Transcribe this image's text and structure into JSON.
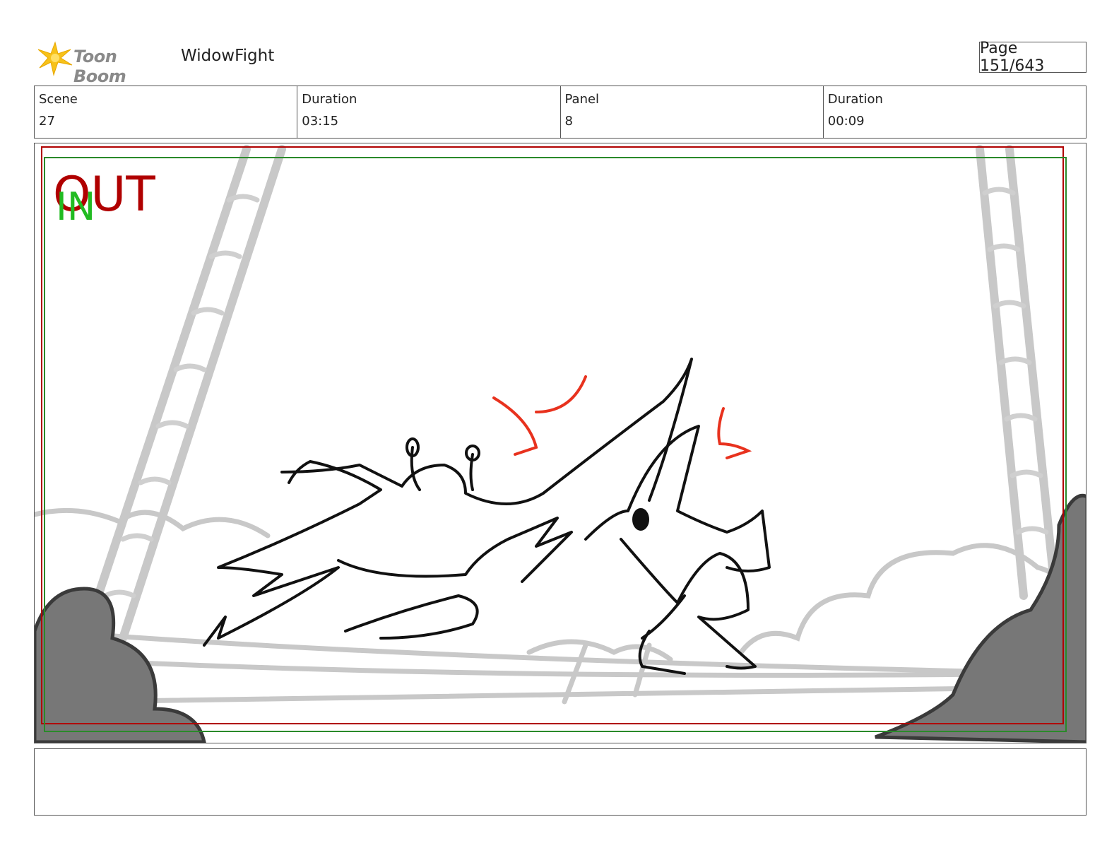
{
  "header": {
    "brand": "Toon Boom",
    "project_title": "WidowFight",
    "page_label": "Page 151/643"
  },
  "info": {
    "scene_label": "Scene",
    "scene_value": "27",
    "scene_duration_label": "Duration",
    "scene_duration_value": "03:15",
    "panel_label": "Panel",
    "panel_value": "8",
    "panel_duration_label": "Duration",
    "panel_duration_value": "00:09"
  },
  "panel": {
    "out_marker": "OUT",
    "in_marker": "IN",
    "out_color": "#b00000",
    "in_color": "#22bb22"
  },
  "caption": {
    "text": ""
  }
}
